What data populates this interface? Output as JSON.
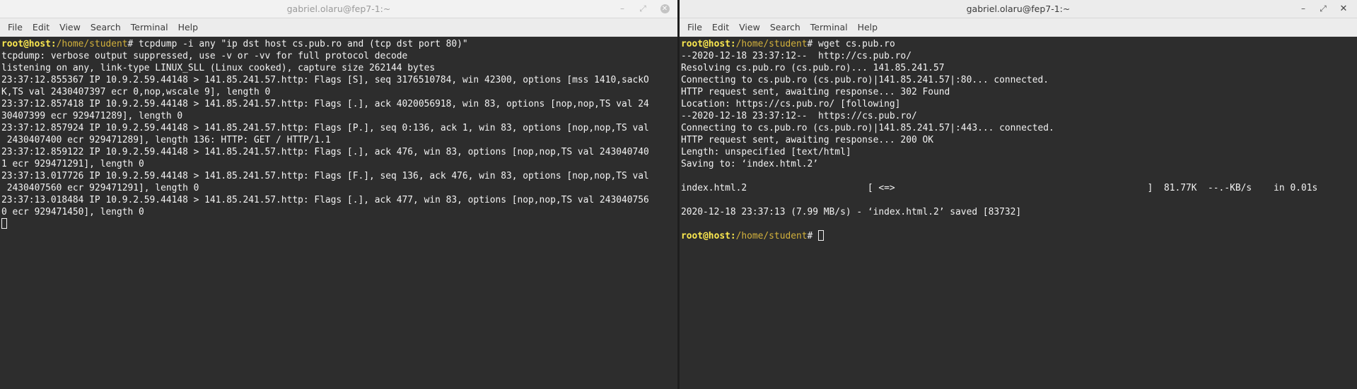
{
  "left": {
    "title": "gabriel.olaru@fep7-1:~",
    "menu": [
      "File",
      "Edit",
      "View",
      "Search",
      "Terminal",
      "Help"
    ],
    "prompt": {
      "user": "root@host:",
      "path": "/home/student",
      "symbol": "# "
    },
    "command": "tcpdump -i any \"ip dst host cs.pub.ro and (tcp dst port 80)\"",
    "output": [
      "tcpdump: verbose output suppressed, use -v or -vv for full protocol decode",
      "listening on any, link-type LINUX_SLL (Linux cooked), capture size 262144 bytes",
      "23:37:12.855367 IP 10.9.2.59.44148 > 141.85.241.57.http: Flags [S], seq 3176510784, win 42300, options [mss 1410,sackO",
      "K,TS val 2430407397 ecr 0,nop,wscale 9], length 0",
      "23:37:12.857418 IP 10.9.2.59.44148 > 141.85.241.57.http: Flags [.], ack 4020056918, win 83, options [nop,nop,TS val 24",
      "30407399 ecr 929471289], length 0",
      "23:37:12.857924 IP 10.9.2.59.44148 > 141.85.241.57.http: Flags [P.], seq 0:136, ack 1, win 83, options [nop,nop,TS val",
      " 2430407400 ecr 929471289], length 136: HTTP: GET / HTTP/1.1",
      "23:37:12.859122 IP 10.9.2.59.44148 > 141.85.241.57.http: Flags [.], ack 476, win 83, options [nop,nop,TS val 243040740",
      "1 ecr 929471291], length 0",
      "23:37:13.017726 IP 10.9.2.59.44148 > 141.85.241.57.http: Flags [F.], seq 136, ack 476, win 83, options [nop,nop,TS val",
      " 2430407560 ecr 929471291], length 0",
      "23:37:13.018484 IP 10.9.2.59.44148 > 141.85.241.57.http: Flags [.], ack 477, win 83, options [nop,nop,TS val 243040756",
      "0 ecr 929471450], length 0"
    ]
  },
  "right": {
    "title": "gabriel.olaru@fep7-1:~",
    "menu": [
      "File",
      "Edit",
      "View",
      "Search",
      "Terminal",
      "Help"
    ],
    "prompt": {
      "user": "root@host:",
      "path": "/home/student",
      "symbol": "# "
    },
    "command": "wget cs.pub.ro",
    "output": [
      "--2020-12-18 23:37:12--  http://cs.pub.ro/",
      "Resolving cs.pub.ro (cs.pub.ro)... 141.85.241.57",
      "Connecting to cs.pub.ro (cs.pub.ro)|141.85.241.57|:80... connected.",
      "HTTP request sent, awaiting response... 302 Found",
      "Location: https://cs.pub.ro/ [following]",
      "--2020-12-18 23:37:12--  https://cs.pub.ro/",
      "Connecting to cs.pub.ro (cs.pub.ro)|141.85.241.57|:443... connected.",
      "HTTP request sent, awaiting response... 200 OK",
      "Length: unspecified [text/html]",
      "Saving to: ‘index.html.2’",
      "",
      "index.html.2                      [ <=>                                              ]  81.77K  --.-KB/s    in 0.01s",
      "",
      "2020-12-18 23:37:13 (7.99 MB/s) - ‘index.html.2’ saved [83732]",
      ""
    ]
  },
  "colors": {
    "terminal_bg": "#2d2d2d",
    "terminal_fg": "#f2f2f2",
    "prompt_user": "#fce94f",
    "prompt_path": "#d4b23c",
    "titlebar_bg": "#ececec"
  },
  "icons": [
    "minimize-icon",
    "maximize-icon",
    "close-icon"
  ]
}
